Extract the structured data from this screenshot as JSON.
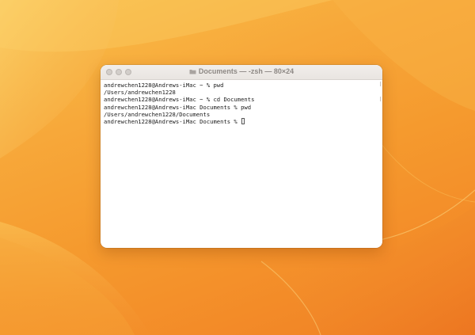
{
  "window": {
    "title": "Documents — -zsh — 80×24",
    "folder_icon": "folder-icon"
  },
  "terminal": {
    "lines": [
      "andrewchen1228@Andrews-iMac ~ % pwd",
      "/Users/andrewchen1228",
      "andrewchen1228@Andrews-iMac ~ % cd Documents",
      "andrewchen1228@Andrews-iMac Documents % pwd",
      "/Users/andrewchen1228/Documents",
      "andrewchen1228@Andrews-iMac Documents % "
    ]
  },
  "colors": {
    "wallpaper_light": "#f9c04a",
    "wallpaper_dark": "#f07f24",
    "titlebar": "#ece8e4",
    "text": "#1c1c1c"
  }
}
